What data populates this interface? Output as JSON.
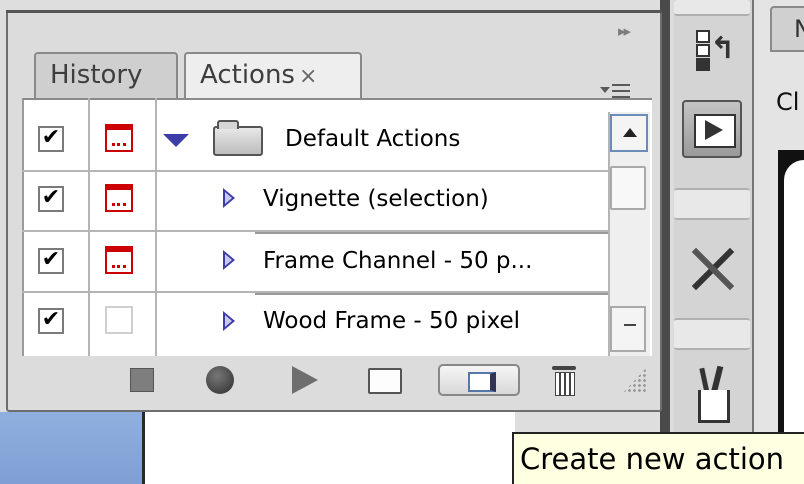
{
  "panel": {
    "tabs": [
      {
        "label": "History",
        "active": false
      },
      {
        "label": "Actions",
        "active": true,
        "close": "×"
      }
    ],
    "collapse_glyph": "▸▸",
    "rows": [
      {
        "checked": "✔",
        "dialog": true,
        "expand": "down",
        "folder": true,
        "label": "Default Actions"
      },
      {
        "checked": "✔",
        "dialog": true,
        "expand": "right",
        "label": "Vignette (selection)"
      },
      {
        "checked": "✔",
        "dialog": true,
        "expand": "right",
        "label": "Frame Channel - 50 p..."
      },
      {
        "checked": "✔",
        "dialog": false,
        "expand": "right",
        "label": "Wood Frame - 50 pixel"
      }
    ],
    "toolbar": [
      "stop-icon",
      "record-icon",
      "play-icon",
      "new-set-icon",
      "new-action-icon",
      "trash-icon"
    ]
  },
  "right_panel": {
    "tab_label": "N",
    "label": "Cl"
  },
  "tooltip": {
    "text": "Create new action"
  },
  "colors": {
    "panel_bg": "#dcdcdc",
    "list_bg": "#ffffff",
    "dialog_red": "#cc0000",
    "triangle_blue": "#3d3daa",
    "tooltip_bg": "#ffffe1"
  }
}
